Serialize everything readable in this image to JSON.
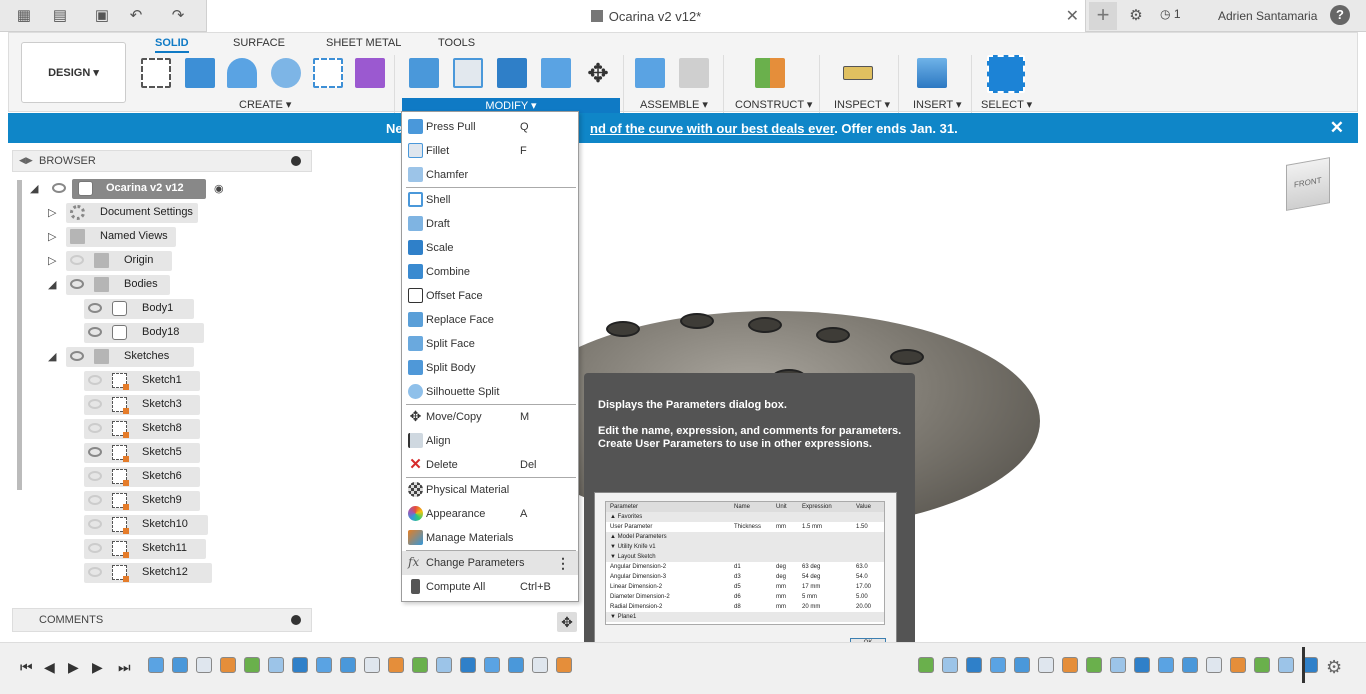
{
  "titlebar": {
    "doc_title": "Ocarina v2 v12*",
    "close_glyph": "✕",
    "plus_glyph": "+",
    "jobs_count": "1",
    "user_name": "Adrien Santamaria",
    "help_glyph": "?"
  },
  "ribbon": {
    "workspace_label": "DESIGN ▾",
    "tabs": [
      "SOLID",
      "SURFACE",
      "SHEET METAL",
      "TOOLS"
    ],
    "groups": {
      "create": "CREATE ▾",
      "modify": "MODIFY ▾",
      "assemble": "ASSEMBLE ▾",
      "construct": "CONSTRUCT ▾",
      "inspect": "INSPECT ▾",
      "insert": "INSERT ▾",
      "select": "SELECT ▾"
    }
  },
  "banner": {
    "text_prefix": "Ne",
    "link_text": "nd of the curve with our best deals ever",
    "text_suffix": ". Offer ends Jan. 31.",
    "close_glyph": "✕"
  },
  "browser": {
    "title": "BROWSER",
    "root": "Ocarina v2 v12",
    "items": {
      "document_settings": "Document Settings",
      "named_views": "Named Views",
      "origin": "Origin",
      "bodies": "Bodies",
      "body1": "Body1",
      "body18": "Body18",
      "sketches": "Sketches",
      "sketch1": "Sketch1",
      "sketch3": "Sketch3",
      "sketch8": "Sketch8",
      "sketch5": "Sketch5",
      "sketch6": "Sketch6",
      "sketch9": "Sketch9",
      "sketch10": "Sketch10",
      "sketch11": "Sketch11",
      "sketch12": "Sketch12"
    }
  },
  "comments": {
    "title": "COMMENTS"
  },
  "modify_menu": {
    "items": [
      {
        "label": "Press Pull",
        "key": "Q"
      },
      {
        "label": "Fillet",
        "key": "F"
      },
      {
        "label": "Chamfer",
        "key": ""
      },
      {
        "label": "Shell",
        "key": ""
      },
      {
        "label": "Draft",
        "key": ""
      },
      {
        "label": "Scale",
        "key": ""
      },
      {
        "label": "Combine",
        "key": ""
      },
      {
        "label": "Offset Face",
        "key": ""
      },
      {
        "label": "Replace Face",
        "key": ""
      },
      {
        "label": "Split Face",
        "key": ""
      },
      {
        "label": "Split Body",
        "key": ""
      },
      {
        "label": "Silhouette Split",
        "key": ""
      },
      {
        "label": "Move/Copy",
        "key": "M"
      },
      {
        "label": "Align",
        "key": ""
      },
      {
        "label": "Delete",
        "key": "Del"
      },
      {
        "label": "Physical Material",
        "key": ""
      },
      {
        "label": "Appearance",
        "key": "A"
      },
      {
        "label": "Manage Materials",
        "key": ""
      },
      {
        "label": "Change Parameters",
        "key": ""
      },
      {
        "label": "Compute All",
        "key": "Ctrl+B"
      }
    ],
    "highlighted": "Change Parameters",
    "more_glyph": "⋮"
  },
  "tooltip": {
    "heading": "Displays the Parameters dialog box.",
    "body": "Edit the name, expression, and comments for parameters. Create User Parameters to use in other expressions.",
    "preview": {
      "headers": [
        "Parameter",
        "Name",
        "Unit",
        "Expression",
        "Value"
      ],
      "rows": [
        {
          "p": "▲ Favorites",
          "n": "",
          "u": "",
          "e": "",
          "v": ""
        },
        {
          "p": "User Parameter",
          "n": "Thickness",
          "u": "mm",
          "e": "1.5 mm",
          "v": "1.50"
        },
        {
          "p": "▲ Model Parameters",
          "n": "",
          "u": "",
          "e": "",
          "v": ""
        },
        {
          "p": "▼ Utility Knife v1",
          "n": "",
          "u": "",
          "e": "",
          "v": ""
        },
        {
          "p": "▼ Layout Sketch",
          "n": "",
          "u": "",
          "e": "",
          "v": ""
        },
        {
          "p": "Angular Dimension-2",
          "n": "d1",
          "u": "deg",
          "e": "63 deg",
          "v": "63.0"
        },
        {
          "p": "Angular Dimension-3",
          "n": "d3",
          "u": "deg",
          "e": "54 deg",
          "v": "54.0"
        },
        {
          "p": "Linear Dimension-2",
          "n": "d5",
          "u": "mm",
          "e": "17 mm",
          "v": "17.00"
        },
        {
          "p": "Diameter Dimension-2",
          "n": "d6",
          "u": "mm",
          "e": "5 mm",
          "v": "5.00"
        },
        {
          "p": "Radial Dimension-2",
          "n": "d8",
          "u": "mm",
          "e": "20 mm",
          "v": "20.00"
        },
        {
          "p": "▼ Plane1",
          "n": "",
          "u": "",
          "e": "",
          "v": ""
        }
      ],
      "ok": "OK"
    }
  },
  "viewcube": {
    "face": "FRONT"
  },
  "colors": {
    "accent": "#0f7ac5",
    "banner": "#0f86c8",
    "tooltip_bg": "#545454"
  }
}
